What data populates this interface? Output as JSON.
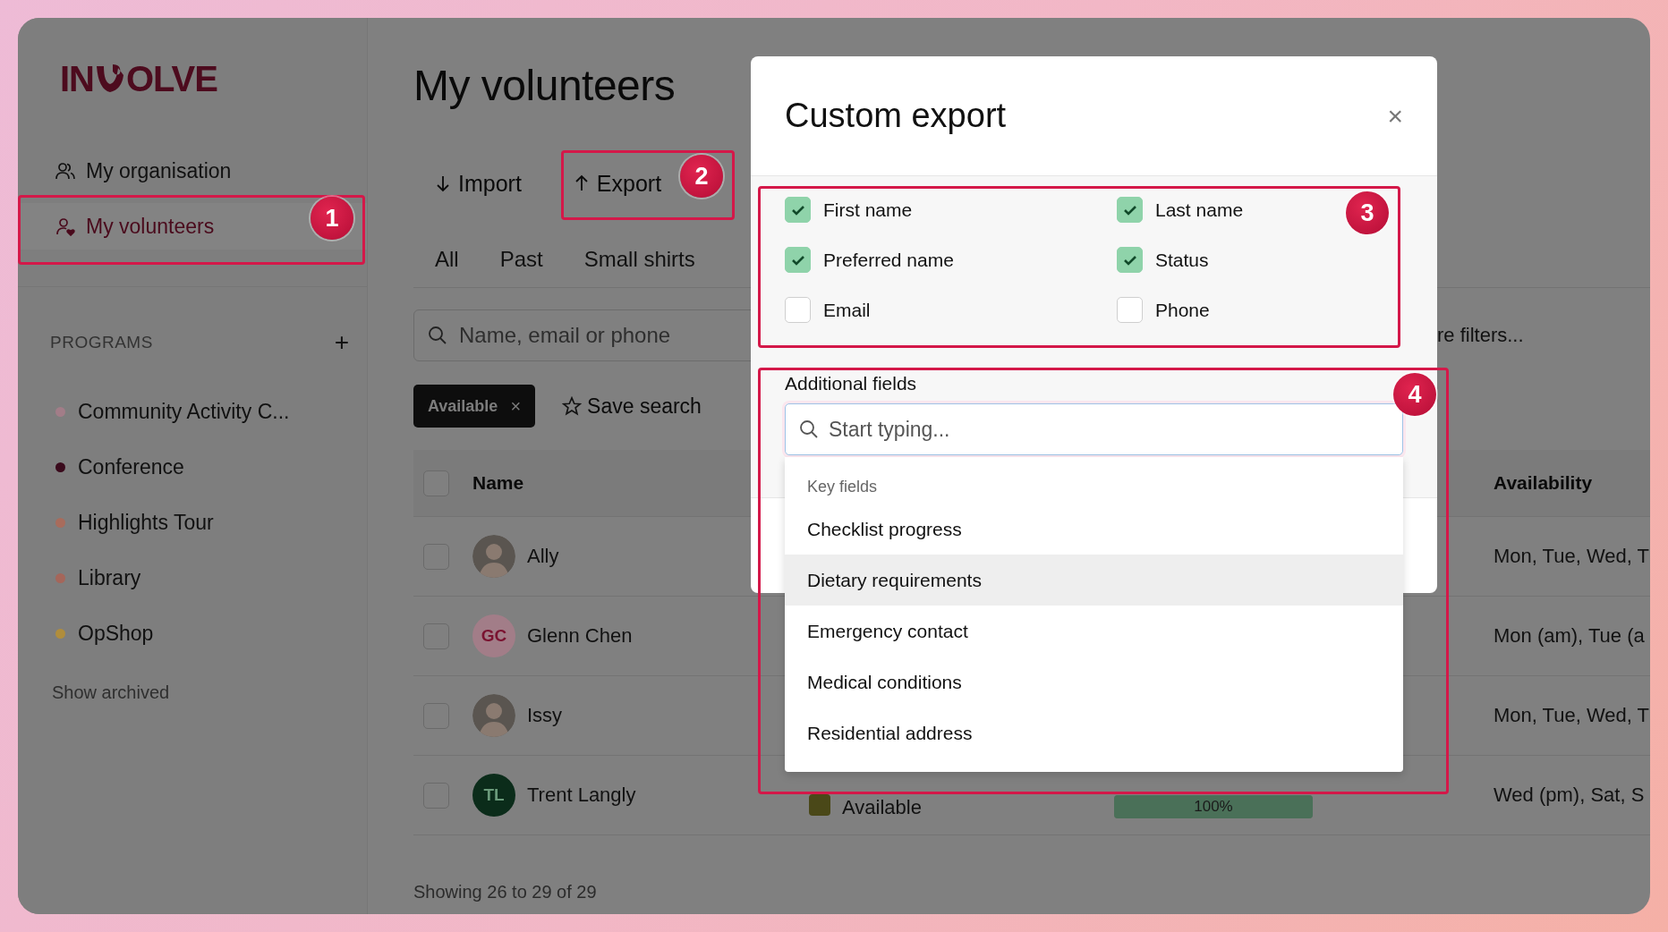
{
  "sidebar": {
    "logo": {
      "start": "IN",
      "end": "OLVE"
    },
    "nav": [
      {
        "label": "My organisation",
        "kind": "people",
        "selected": false
      },
      {
        "label": "My volunteers",
        "kind": "person",
        "selected": true
      }
    ],
    "programs_heading": "PROGRAMS",
    "add_button": "+",
    "programs": [
      {
        "label": "Community Activity C...",
        "color": "#a27d88"
      },
      {
        "label": "Conference",
        "color": "#3a0a1c"
      },
      {
        "label": "Highlights Tour",
        "color": "#a86c5c"
      },
      {
        "label": "Library",
        "color": "#a5665a"
      },
      {
        "label": "OpShop",
        "color": "#b08d3c"
      }
    ],
    "show_archived": "Show archived"
  },
  "page": {
    "title": "My volunteers",
    "actions": [
      {
        "label": "Import",
        "kind": "import"
      },
      {
        "label": "Export",
        "kind": "export"
      }
    ],
    "tabs": [
      "All",
      "Past",
      "Small shirts"
    ],
    "search": {
      "placeholder": "Name, email or phone"
    },
    "more_filters": "re filters...",
    "chips": [
      {
        "label": "Available",
        "remove": "×"
      }
    ],
    "save_search": "Save search",
    "table": {
      "header_checked": false,
      "columns": [
        {
          "label": "Name",
          "kind": "name"
        },
        {
          "label": "Availability",
          "kind": "availability"
        }
      ],
      "rows": [
        {
          "checked": false,
          "name": "Ally",
          "avatar": {
            "kind": "photo"
          },
          "availability": "Mon, Tue, Wed, T"
        },
        {
          "checked": false,
          "name": "Glenn Chen",
          "avatar": {
            "kind": "initials",
            "initials": "GC",
            "color": "#a27d88"
          },
          "availability": "Mon (am), Tue (a"
        },
        {
          "checked": false,
          "name": "Issy",
          "avatar": {
            "kind": "photo"
          },
          "availability": "Mon, Tue, Wed, T"
        },
        {
          "checked": false,
          "name": "Trent Langly",
          "avatar": {
            "kind": "initials",
            "initials": "TL",
            "color": "#0b2c1a"
          },
          "status": {
            "label": "Available",
            "color": "#4a4818"
          },
          "progress": {
            "label": "100%",
            "level": 1
          },
          "availability": "Wed (pm), Sat, S"
        }
      ]
    },
    "footer": "Showing 26 to 29 of 29"
  },
  "dialog": {
    "title": "Custom export",
    "close": "×",
    "fields": [
      {
        "label": "First name",
        "checked": true
      },
      {
        "label": "Last name",
        "checked": true
      },
      {
        "label": "Preferred name",
        "checked": true
      },
      {
        "label": "Status",
        "checked": true
      },
      {
        "label": "Email",
        "checked": false
      },
      {
        "label": "Phone",
        "checked": false
      }
    ],
    "additional_label": "Additional fields",
    "search": {
      "placeholder": "Start typing..."
    },
    "dropdown": {
      "group": "Key fields",
      "options": [
        {
          "label": "Checklist progress",
          "selected": false
        },
        {
          "label": "Dietary requirements",
          "selected": true
        },
        {
          "label": "Emergency contact",
          "selected": false
        },
        {
          "label": "Medical conditions",
          "selected": false
        },
        {
          "label": "Residential address",
          "selected": false
        }
      ]
    }
  },
  "annotations": [
    "1",
    "2",
    "3",
    "4"
  ]
}
